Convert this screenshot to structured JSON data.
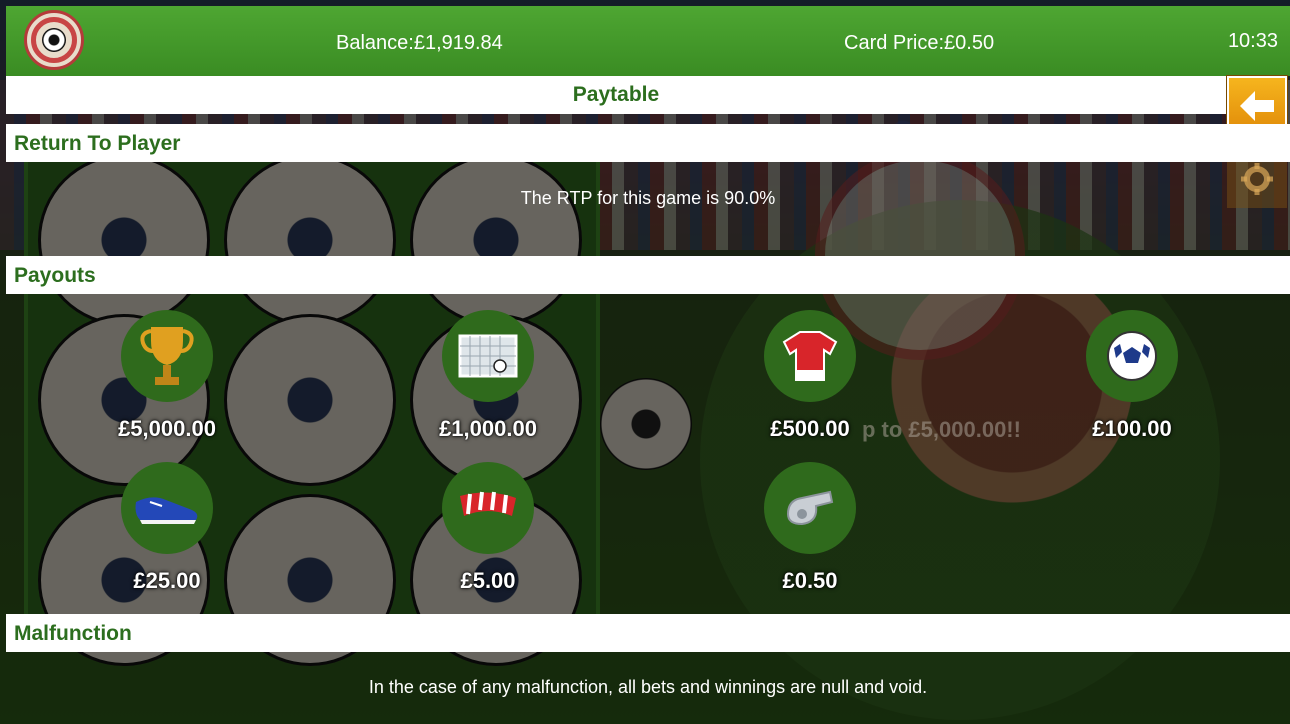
{
  "topbar": {
    "logo": "winning-match-logo",
    "balance": "Balance:£1,919.84",
    "card_price": "Card Price:£0.50",
    "clock": "10:33"
  },
  "title": "Paytable",
  "icons": {
    "back": "back-arrow-icon",
    "settings": "gear-icon"
  },
  "sections": {
    "rtp": {
      "heading": "Return To Player",
      "text": "The RTP for this game is 90.0%"
    },
    "payouts": {
      "heading": "Payouts",
      "background_text": "p to £5,000.00!!",
      "prizes": [
        {
          "icon": "trophy-icon",
          "amount": "£5,000.00"
        },
        {
          "icon": "goal-net-icon",
          "amount": "£1,000.00"
        },
        {
          "icon": "jersey-icon",
          "amount": "£500.00"
        },
        {
          "icon": "football-icon",
          "amount": "£100.00"
        },
        {
          "icon": "boot-icon",
          "amount": "£25.00"
        },
        {
          "icon": "scarf-icon",
          "amount": "£5.00"
        },
        {
          "icon": "whistle-icon",
          "amount": "£0.50"
        }
      ]
    },
    "malfunction": {
      "heading": "Malfunction",
      "text": "In the case of any malfunction, all bets and winnings are null and void."
    }
  },
  "colors": {
    "header_green": "#3a8c23",
    "heading_text": "#2c6e1e",
    "back_button": "#f0a010"
  }
}
